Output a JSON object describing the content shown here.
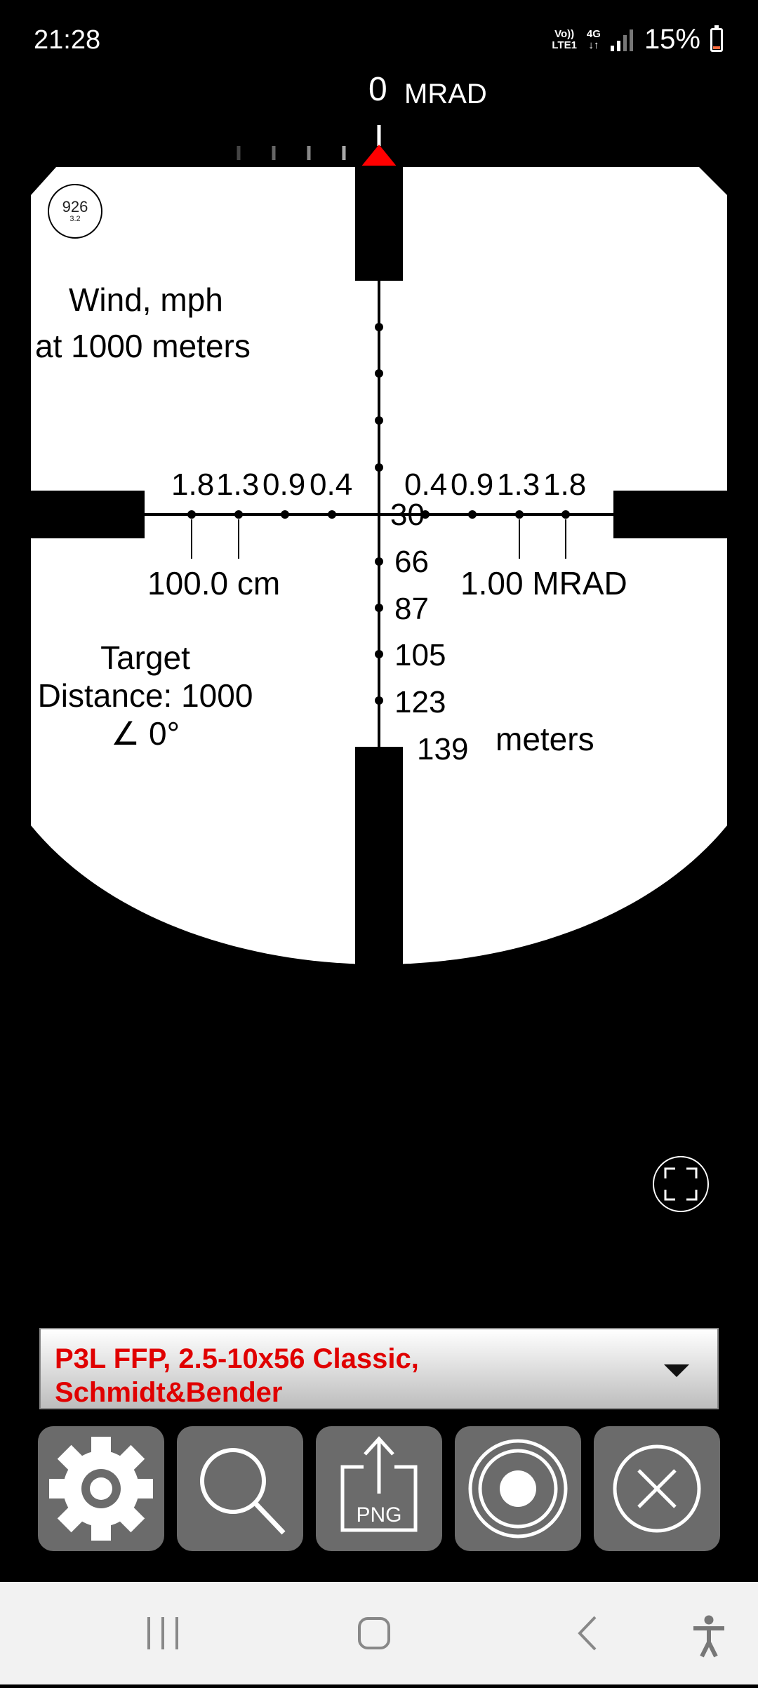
{
  "status_bar": {
    "time": "21:28",
    "network_line1": "Vo))",
    "network_line2": "LTE1",
    "network_type": "4G",
    "battery": "15%",
    "battery_level": 0.15
  },
  "scale": {
    "readout": "0",
    "unit": "MRAD"
  },
  "reticle": {
    "badge_main": "926",
    "badge_sub": "3.2",
    "wind_title": "Wind, mph",
    "wind_distance": "at 1000 meters",
    "wind_left": [
      "1.8",
      "1.3",
      "0.9",
      "0.4"
    ],
    "wind_right": [
      "0.4",
      "0.9",
      "1.3",
      "1.8"
    ],
    "size_label": "100.0 cm",
    "mrad_label": "1.00 MRAD",
    "target_line1": "Target",
    "target_line2": "Distance: 1000",
    "target_line3": "∠ 0°",
    "range_values": [
      "30",
      "66",
      "87",
      "105",
      "123",
      "139"
    ],
    "range_unit": "meters"
  },
  "scope_selector": {
    "selected": "P3L FFP, 2.5-10x56 Classic, Schmidt&Bender"
  },
  "toolbar": {
    "png_label": "PNG"
  },
  "colors": {
    "marker": "#ff0000",
    "selector_text": "#e00000",
    "button_bg": "#6b6b6b"
  }
}
